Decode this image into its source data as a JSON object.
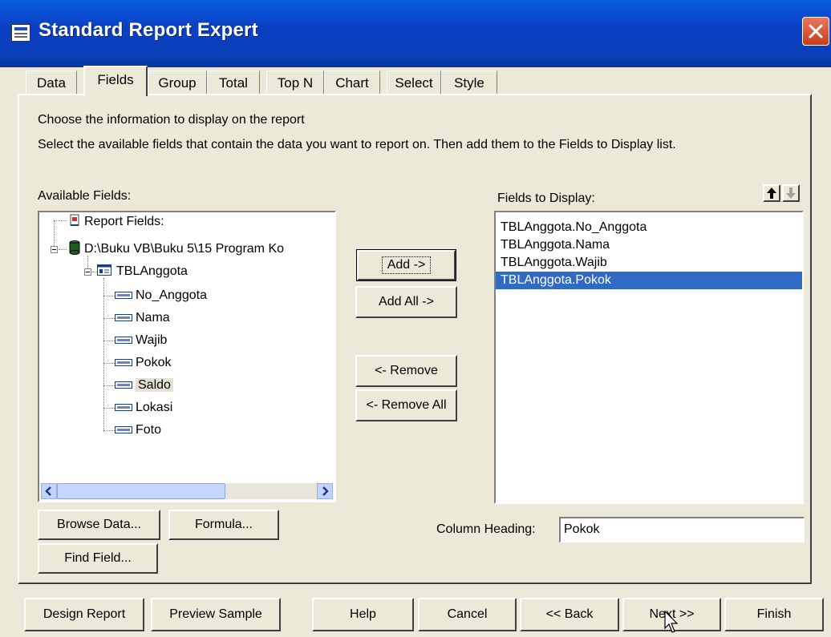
{
  "window": {
    "title": "Standard Report Expert"
  },
  "tabs": [
    {
      "label": "Data"
    },
    {
      "label": "Fields"
    },
    {
      "label": "Group"
    },
    {
      "label": "Total"
    },
    {
      "label": "Top N"
    },
    {
      "label": "Chart"
    },
    {
      "label": "Select"
    },
    {
      "label": "Style"
    }
  ],
  "instructions": {
    "line1": "Choose the information to display on the report",
    "line2": "Select the available fields that contain the data you want to report on.  Then add them to the Fields to Display list."
  },
  "available": {
    "label": "Available Fields:",
    "report_fields": "Report Fields:",
    "database": "D:\\Buku VB\\Buku 5\\15 Program Ko",
    "table": "TBLAnggota",
    "fields": [
      "No_Anggota",
      "Nama",
      "Wajib",
      "Pokok",
      "Saldo",
      "Lokasi",
      "Foto"
    ]
  },
  "buttons": {
    "add": "Add ->",
    "add_all": "Add All ->",
    "remove": "<- Remove",
    "remove_all": "<- Remove All",
    "browse": "Browse Data...",
    "formula": "Formula...",
    "find": "Find Field..."
  },
  "display": {
    "label": "Fields to Display:",
    "items": [
      "TBLAnggota.No_Anggota",
      "TBLAnggota.Nama",
      "TBLAnggota.Wajib",
      "TBLAnggota.Pokok"
    ]
  },
  "column_heading": {
    "label": "Column Heading:",
    "value": "Pokok"
  },
  "footer": {
    "design": "Design Report",
    "preview": "Preview Sample",
    "help": "Help",
    "cancel": "Cancel",
    "back": "<< Back",
    "next": "Next >>",
    "finish": "Finish"
  },
  "colors": {
    "title_bar": "#0a3fc4",
    "selection": "#316ac5",
    "face": "#ece9d8"
  }
}
